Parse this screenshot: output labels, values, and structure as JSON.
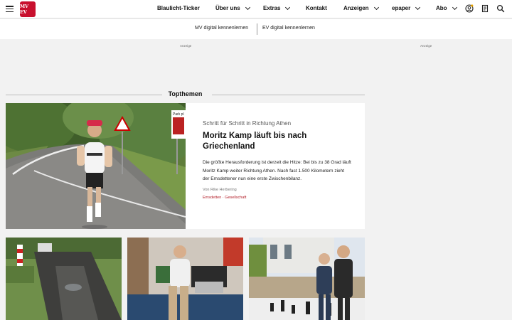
{
  "header": {
    "logo_text": "MV EV",
    "nav": [
      {
        "label": "Blaulicht-Ticker",
        "has_dropdown": false
      },
      {
        "label": "Über uns",
        "has_dropdown": true
      },
      {
        "label": "Extras",
        "has_dropdown": true
      },
      {
        "label": "Kontakt",
        "has_dropdown": false
      },
      {
        "label": "Anzeigen",
        "has_dropdown": true
      },
      {
        "label": "epaper",
        "has_dropdown": true
      },
      {
        "label": "Abo",
        "has_dropdown": true
      }
    ],
    "icons": [
      "account-icon",
      "epaper-icon",
      "search-icon"
    ]
  },
  "subnav": {
    "left_link": "MV digital kennenlernen",
    "right_link": "EV digital kennenlernen"
  },
  "ads": {
    "label": "Anzeige"
  },
  "section": {
    "title": "Topthemen"
  },
  "feature": {
    "kicker": "Schritt für Schritt in Richtung Athen",
    "headline": "Moritz Kamp läuft bis nach Griechenland",
    "teaser": "Die größte Herausforderung ist derzeit die Hitze: Bei bis zu 38 Grad läuft Moritz Kamp weiter Richtung Athen. Nach fast 1.500 Kilometern zieht der Emsdettener nun eine erste Zwischenbilanz.",
    "author": "Von Rike Herbering",
    "tags": "Emsdetten · Gesellschaft",
    "sign_text": "Park pl"
  },
  "colors": {
    "brand": "#c8102e",
    "tag": "#b3202a",
    "background": "#f2f2f2"
  }
}
